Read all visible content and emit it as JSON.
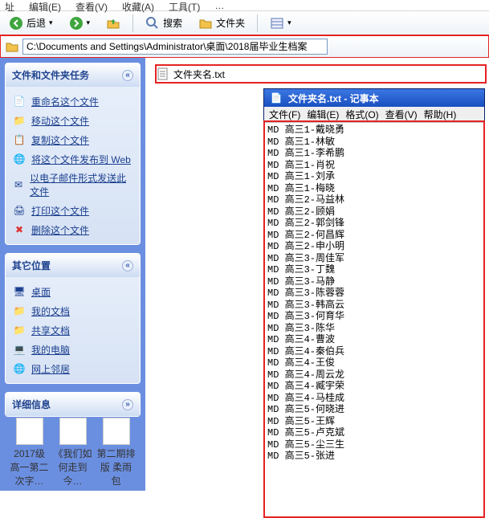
{
  "menus": {
    "m0": "址",
    "m1": "编辑(E)",
    "m2": "查看(V)",
    "m3": "收藏(A)",
    "m4": "工具(T)",
    "m5": "…"
  },
  "toolbar": {
    "back": "后退",
    "search": "搜索",
    "folders": "文件夹"
  },
  "address": {
    "path": "C:\\Documents and Settings\\Administrator\\桌面\\2018届毕业生档案"
  },
  "content_file": {
    "name": "文件夹名.txt"
  },
  "sidebar": {
    "panel1": {
      "title": "文件和文件夹任务",
      "items": [
        "重命名这个文件",
        "移动这个文件",
        "复制这个文件",
        "将这个文件发布到 Web",
        "以电子邮件形式发送此文件",
        "打印这个文件",
        "删除这个文件"
      ]
    },
    "panel2": {
      "title": "其它位置",
      "items": [
        "桌面",
        "我的文档",
        "共享文档",
        "我的电脑",
        "网上邻居"
      ]
    },
    "panel3": {
      "title": "详细信息"
    }
  },
  "notepad": {
    "title": "文件夹名.txt - 记事本",
    "menu": {
      "file": "文件(F)",
      "edit": "编辑(E)",
      "format": "格式(O)",
      "view": "查看(V)",
      "help": "帮助(H)"
    },
    "lines": [
      "MD 高三1-戴晓勇",
      "MD 高三1-林敏",
      "MD 高三1-李希鹏",
      "MD 高三1-肖祝",
      "MD 高三1-刘承",
      "MD 高三1-梅晓",
      "MD 高三2-马益林",
      "MD 高三2-顾娟",
      "MD 高三2-郭剑锋",
      "MD 高三2-何昌辉",
      "MD 高三2-申小明",
      "MD 高三3-周佳军",
      "MD 高三3-丁魏",
      "MD 高三3-马静",
      "MD 高三3-陈蓉蓉",
      "MD 高三3-韩高云",
      "MD 高三3-何育华",
      "MD 高三3-陈华",
      "MD 高三4-曹波",
      "MD 高三4-秦伯兵",
      "MD 高三4-王俊",
      "MD 高三4-周云龙",
      "MD 高三4-臧宇荣",
      "MD 高三4-马桂成",
      "MD 高三5-何晓进",
      "MD 高三5-王辉",
      "MD 高三5-卢克斌",
      "MD 高三5-尘三生",
      "MD 高三5-张进"
    ]
  },
  "desktop": {
    "i0": "2017级高一第二次字…",
    "i1": "《我们如何走到今…",
    "i2": "第二期排版 柔雨包"
  }
}
